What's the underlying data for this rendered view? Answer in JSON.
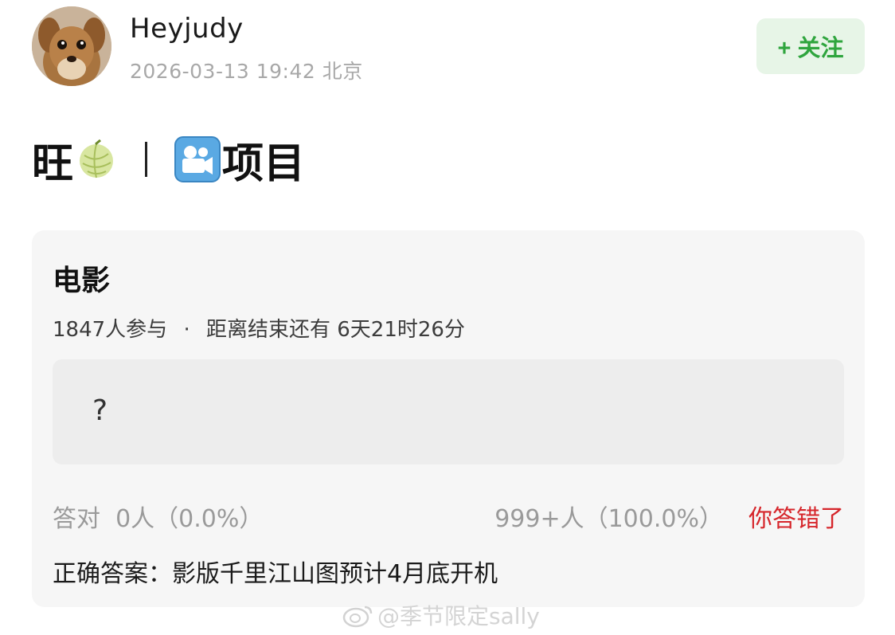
{
  "header": {
    "username": "Heyjudy",
    "timestamp": "2026-03-13 19:42",
    "location": "北京",
    "follow_label": "+ 关注",
    "avatar_icon": "dog-avatar"
  },
  "post": {
    "text_start": "旺",
    "melon_icon": "melon-emoji",
    "movie_icon": "movie-camera-emoji",
    "text_end": "项目"
  },
  "quiz": {
    "title": "电影",
    "participants": "1847人参与",
    "separator": "·",
    "countdown": "距离结束还有 6天21时26分",
    "answer_text": "?",
    "correct_stat": "答对  0人（0.0%）",
    "wrong_stat": "999+人（100.0%）",
    "user_result": "你答错了",
    "correct_answer": "正确答案：影版千里江山图预计4月底开机"
  },
  "watermark": {
    "text": "@季节限定sally",
    "icon": "weibo-icon"
  },
  "colors": {
    "follow_bg": "#e7f5e7",
    "follow_text": "#2fa53e",
    "wrong_red": "#d6262b",
    "card_bg": "#f6f6f6"
  }
}
